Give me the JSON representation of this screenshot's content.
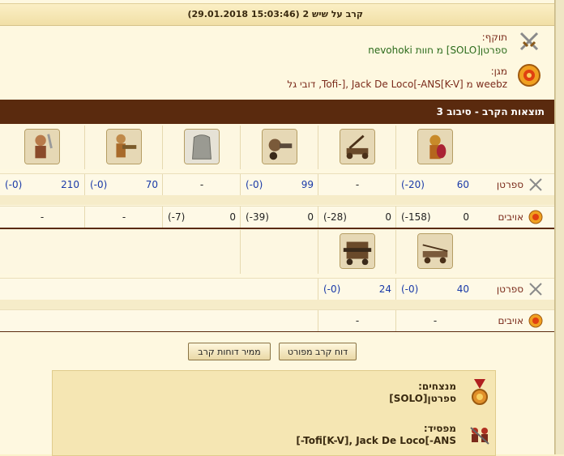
{
  "header": {
    "title": "קרב על שיש 2 (15:03:46 29.01.2018)"
  },
  "attacker": {
    "label": "תוקף:",
    "value": "ספרטן[SOLO] מ חוות nevohoki"
  },
  "defender": {
    "label": "מגן:",
    "value": "weebz מ [K-V]Tofi-], Jack De Loco[-ANS, דובי גל"
  },
  "round": {
    "title": "תוצאות הקרב - סיבוב 3"
  },
  "rows": {
    "spartan_label": "ספרטן",
    "enemies_label": "אויבים"
  },
  "table1": {
    "units": [
      "hoplite-unit",
      "catapult-unit",
      "cannon-soldier-unit",
      "stone-wall-unit",
      "gunner-unit",
      "barbarian-unit"
    ],
    "spartan": [
      {
        "a": "60",
        "b": "(-20)"
      },
      {
        "c": "-"
      },
      {
        "a": "99",
        "b": "(-0)"
      },
      {
        "c": "-"
      },
      {
        "a": "70",
        "b": "(-0)"
      },
      {
        "a": "210",
        "b": "(-0)"
      }
    ],
    "enemies": [
      {
        "a": "0",
        "b": "(-158)"
      },
      {
        "a": "0",
        "b": "(-28)"
      },
      {
        "a": "0",
        "b": "(-39)"
      },
      {
        "a": "0",
        "b": "(-7)"
      },
      {
        "c": "-"
      },
      {
        "c": "-"
      }
    ]
  },
  "table2": {
    "units": [
      "ballista-unit",
      "siege-ram-unit"
    ],
    "spartan": [
      {
        "a": "40",
        "b": "(-0)"
      },
      {
        "a": "24",
        "b": "(-0)"
      }
    ],
    "enemies": [
      {
        "c": "-"
      },
      {
        "c": "-"
      }
    ]
  },
  "buttons": {
    "detailed": "דוח קרב מפורט",
    "converter": "ממיר דוחות קרב"
  },
  "summary": {
    "winners_label": "מנצחים:",
    "winners_value": "ספרטן[SOLO]",
    "loser_label": "מפסיד:",
    "loser_value": "[-Tofi[K-V], Jack De Loco[-ANS"
  },
  "colors": {
    "accent": "#5a2a0e",
    "blue_text": "#1a3aa8",
    "label_text": "#7a2a1a",
    "green_text": "#2a6a1a"
  }
}
